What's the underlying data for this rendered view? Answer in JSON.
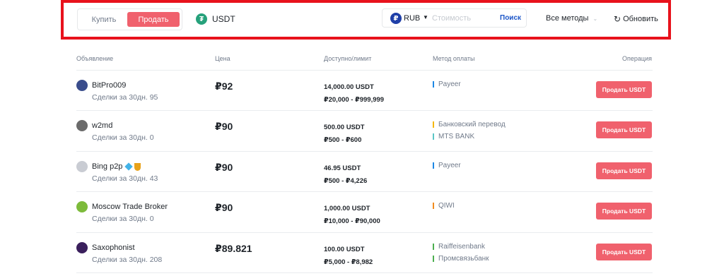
{
  "filter": {
    "buy_label": "Купить",
    "sell_label": "Продать",
    "coin": "USDT",
    "coin_icon": "tether-icon",
    "fiat": "RUB",
    "fiat_icon": "ruble-icon",
    "amount_placeholder": "Стоимость",
    "search_label": "Поиск",
    "methods_label": "Все методы",
    "refresh_label": "Обновить"
  },
  "colors": {
    "accent_sell": "#f0616d",
    "search_link": "#1b55c8",
    "highlight_border": "#e8121c",
    "tether": "#26a17b"
  },
  "table": {
    "headers": {
      "ad": "Объявление",
      "price": "Цена",
      "available": "Доступно/лимит",
      "payment": "Метод оплаты",
      "operation": "Операция"
    },
    "rows": [
      {
        "name": "BitPro009",
        "trades": "Сделки за 30дн. 95",
        "price": "₽92",
        "available": "14,000.00 USDT",
        "limit": "₽20,000 - ₽999,999",
        "methods": [
          {
            "name": "Payeer",
            "color": "#1e88e5"
          }
        ],
        "action": "Продать USDT",
        "avatar_color": "#3a4d8c"
      },
      {
        "name": "w2md",
        "trades": "Сделки за 30дн. 0",
        "price": "₽90",
        "available": "500.00 USDT",
        "limit": "₽500 - ₽600",
        "methods": [
          {
            "name": "Банковский перевод",
            "color": "#f5b70a"
          },
          {
            "name": "MTS BANK",
            "color": "#5bc6c6"
          }
        ],
        "action": "Продать USDT",
        "avatar_color": "#6b6b6b"
      },
      {
        "name": "Bing p2p",
        "trades": "Сделки за 30дн. 43",
        "price": "₽90",
        "available": "46.95 USDT",
        "limit": "₽500 - ₽4,226",
        "methods": [
          {
            "name": "Payeer",
            "color": "#1e88e5"
          }
        ],
        "action": "Продать USDT",
        "avatar_color": "#c9ccd3",
        "badges": [
          "diamond-badge-icon",
          "medal-badge-icon"
        ]
      },
      {
        "name": "Moscow Trade Broker",
        "trades": "Сделки за 30дн. 0",
        "price": "₽90",
        "available": "1,000.00 USDT",
        "limit": "₽10,000 - ₽90,000",
        "methods": [
          {
            "name": "QIWI",
            "color": "#f28c1f"
          }
        ],
        "action": "Продать USDT",
        "avatar_color": "#7dbb3b"
      },
      {
        "name": "Saxophonist",
        "trades": "Сделки за 30дн. 208",
        "price": "₽89.821",
        "available": "100.00 USDT",
        "limit": "₽5,000 - ₽8,982",
        "methods": [
          {
            "name": "Raiffeisenbank",
            "color": "#4caf50"
          },
          {
            "name": "Промсвязьбанк",
            "color": "#4caf50"
          }
        ],
        "action": "Продать USDT",
        "avatar_color": "#3a1f5c"
      }
    ]
  }
}
